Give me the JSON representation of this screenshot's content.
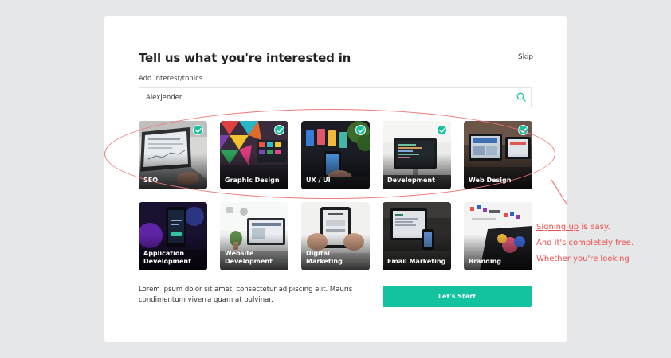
{
  "header": {
    "title": "Tell us what you're interested in",
    "skip_label": "Skip"
  },
  "search": {
    "label": "Add Interest/topics",
    "value": "Alexjender",
    "icon": "search-icon"
  },
  "topics": [
    {
      "label": "SEO",
      "selected": true
    },
    {
      "label": "Graphic Design",
      "selected": true
    },
    {
      "label": "UX / UI",
      "selected": true
    },
    {
      "label": "Development",
      "selected": true
    },
    {
      "label": "Web Design",
      "selected": true
    },
    {
      "label": "Application\nDevelopment",
      "selected": false
    },
    {
      "label": "Website\nDevelopment",
      "selected": false
    },
    {
      "label": "Digital Marketing",
      "selected": false
    },
    {
      "label": "Email Marketing",
      "selected": false
    },
    {
      "label": "Branding",
      "selected": false
    }
  ],
  "note": {
    "link": "Signing up",
    "line1_rest": " is easy.",
    "line2": "And it's completely free.",
    "line3": "Whether you're looking"
  },
  "footer": {
    "description": "Lorem ipsum dolor sit amet, consectetur adipiscing elit. Mauris condimentum viverra quam at pulvinar.",
    "start_label": "Let's Start"
  },
  "colors": {
    "accent": "#13c29e",
    "annotation": "#ef4e4e",
    "background": "#e6e7e9"
  }
}
